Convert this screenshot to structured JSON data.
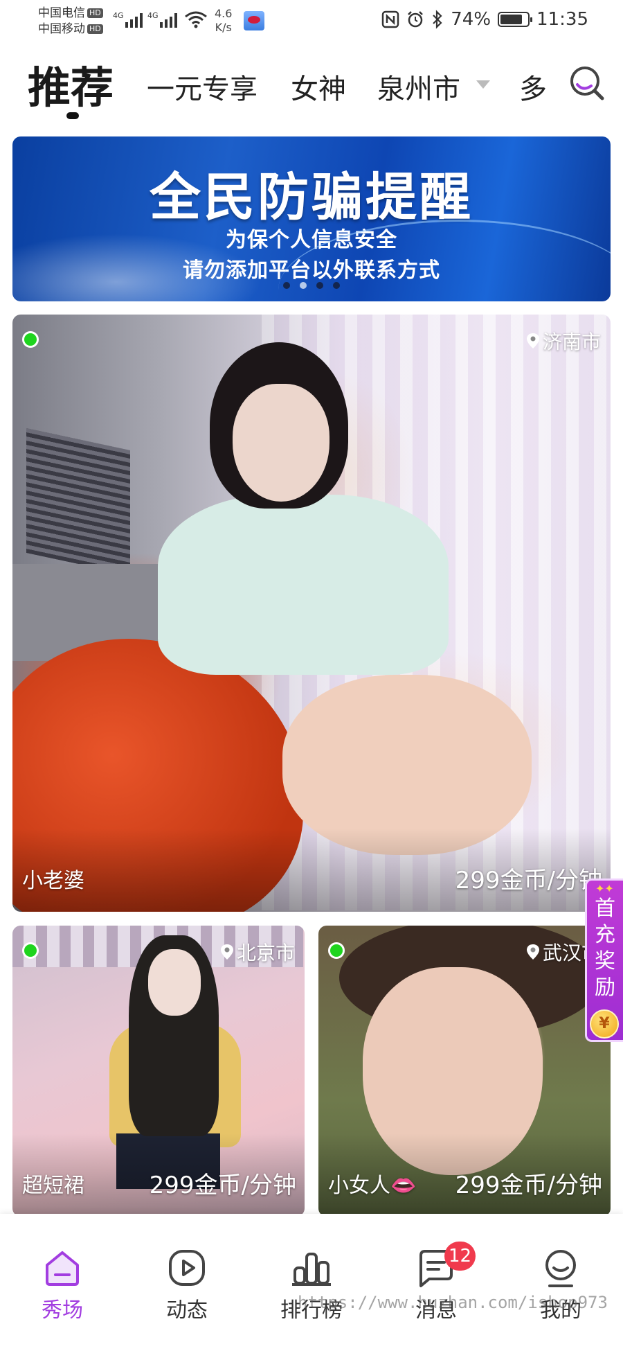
{
  "status_bar": {
    "carrier_1": "中国电信",
    "carrier_2": "中国移动",
    "hd_label": "HD",
    "network_1": "4G",
    "network_2": "4G",
    "net_speed_value": "4.6",
    "net_speed_unit": "K/s",
    "battery": "74%",
    "time": "11:35"
  },
  "header": {
    "tabs": [
      {
        "label": "推荐",
        "active": true
      },
      {
        "label": "一元专享",
        "active": false
      },
      {
        "label": "女神",
        "active": false
      },
      {
        "label": "泉州市",
        "active": false
      },
      {
        "label": "多",
        "active": false
      }
    ],
    "search_icon": "search-icon"
  },
  "banner": {
    "title": "全民防骗提醒",
    "line_1": "为保个人信息安全",
    "line_2": "请勿添加平台以外联系方式",
    "slide_count": 4,
    "active_slide": 2
  },
  "cards": [
    {
      "name": "小老婆",
      "location": "济南市",
      "price": "299金币/分钟",
      "online": true
    },
    {
      "name": "超短裙",
      "location": "北京市",
      "price": "299金币/分钟",
      "online": true
    },
    {
      "name": "小女人👄",
      "location": "武汉市",
      "price": "299金币/分钟",
      "online": true
    }
  ],
  "promo": {
    "label": "首充奖励",
    "coin_text": "¥"
  },
  "bottom_nav": [
    {
      "label": "秀场",
      "icon": "home-icon",
      "active": true
    },
    {
      "label": "动态",
      "icon": "play-icon",
      "active": false
    },
    {
      "label": "排行榜",
      "icon": "ranking-icon",
      "active": false
    },
    {
      "label": "消息",
      "icon": "message-icon",
      "active": false,
      "badge": "12"
    },
    {
      "label": "我的",
      "icon": "profile-icon",
      "active": false
    }
  ],
  "watermark": "https://www.huzhan.com/ishop973",
  "colors": {
    "accent": "#a23de0",
    "online": "#1ed41e",
    "badge": "#f03a4d",
    "banner": "#1d5fc9"
  }
}
